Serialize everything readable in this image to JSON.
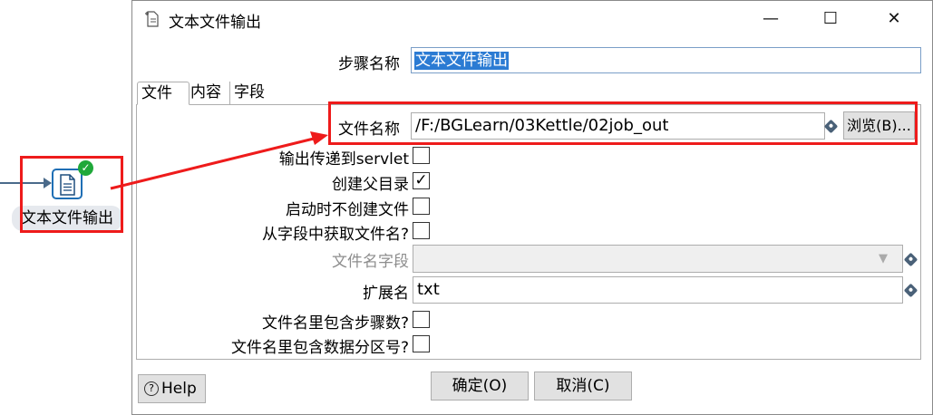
{
  "canvas": {
    "step_label": "文本文件输出"
  },
  "dialog": {
    "title": "文本文件输出",
    "window_controls": {
      "minimize": "—",
      "maximize": "☐",
      "close": "✕"
    },
    "step_name_label": "步骤名称",
    "step_name_value": "文本文件输出",
    "tabs": [
      {
        "label": "文件"
      },
      {
        "label": "内容"
      },
      {
        "label": "字段"
      }
    ],
    "file": {
      "filename_label": "文件名称",
      "filename_value": "/F:/BGLearn/03Kettle/02job_out",
      "browse_label": "浏览(B)...",
      "servlet_label": "输出传递到servlet",
      "create_parent_label": "创建父目录",
      "create_parent_checked": true,
      "no_create_on_start_label": "启动时不创建文件",
      "from_field_label": "从字段中获取文件名?",
      "filename_field_label": "文件名字段",
      "extension_label": "扩展名",
      "extension_value": "txt",
      "include_stepnr_label": "文件名里包含步骤数?",
      "include_partnr_label": "文件名里包含数据分区号?"
    },
    "buttons": {
      "help": "Help",
      "ok": "确定(O)",
      "cancel": "取消(C)"
    }
  },
  "colors": {
    "highlight_red": "#ee1b1b",
    "selection_blue": "#2b7bd3",
    "success_green": "#1fa83a"
  }
}
